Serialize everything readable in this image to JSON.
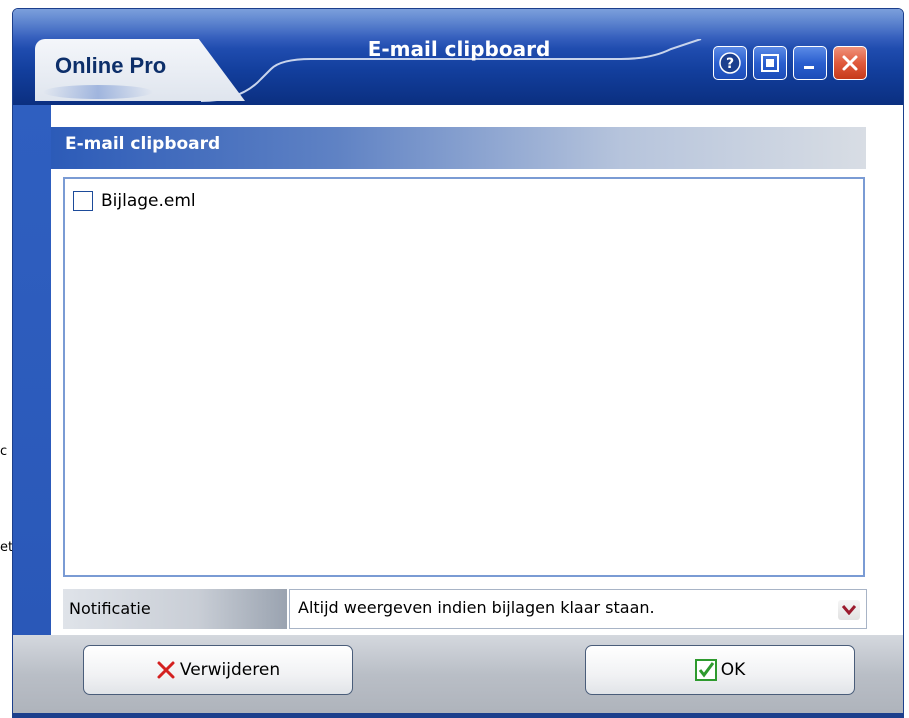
{
  "background": {
    "fragment_1": "c",
    "fragment_2": "et"
  },
  "window": {
    "brand": "Online Pro",
    "title": "E-mail clipboard",
    "title_buttons": [
      {
        "name": "help-icon"
      },
      {
        "name": "restore-icon"
      },
      {
        "name": "minimize-icon"
      },
      {
        "name": "close-icon"
      }
    ]
  },
  "section": {
    "title": "E-mail clipboard"
  },
  "attachments": [
    {
      "label": "Bijlage.eml",
      "checked": false
    }
  ],
  "notification": {
    "label": "Notificatie",
    "selected": "Altijd weergeven indien bijlagen klaar staan."
  },
  "buttons": {
    "delete_label": "Verwijderen",
    "ok_label": "OK"
  },
  "colors": {
    "title_bar": "#123e9c",
    "accent": "#2a58b8",
    "delete_icon": "#d42020",
    "ok_icon": "#2e9a2e"
  }
}
